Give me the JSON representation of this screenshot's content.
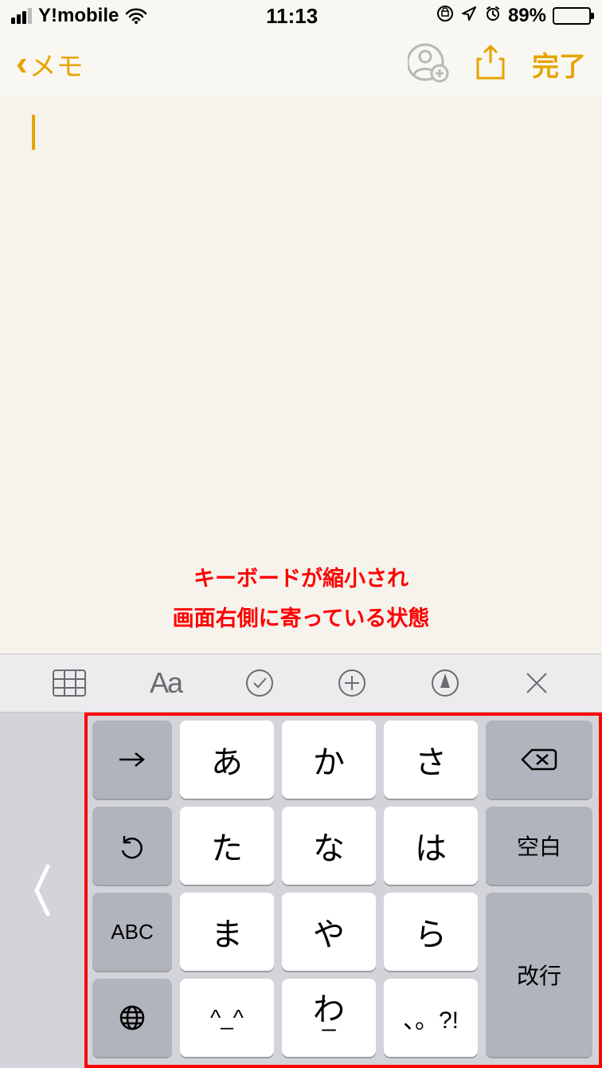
{
  "status": {
    "carrier": "Y!mobile",
    "time": "11:13",
    "battery_pct": "89%"
  },
  "nav": {
    "back_label": "メモ",
    "done_label": "完了"
  },
  "annotation": {
    "line1": "キーボードが縮小され",
    "line2": "画面右側に寄っている状態"
  },
  "toolbar": {
    "aa_label": "Aa"
  },
  "keyboard": {
    "keys": {
      "a": "あ",
      "ka": "か",
      "sa": "さ",
      "ta": "た",
      "na": "な",
      "ha": "は",
      "ma": "ま",
      "ya": "や",
      "ra": "ら",
      "face": "^_^",
      "wa": "わ",
      "wa_sub": "ー",
      "sym": "、。?!",
      "abc": "ABC",
      "space": "空白",
      "return": "改行"
    }
  },
  "colors": {
    "accent": "#e6a400",
    "annotation": "#ff0000"
  }
}
